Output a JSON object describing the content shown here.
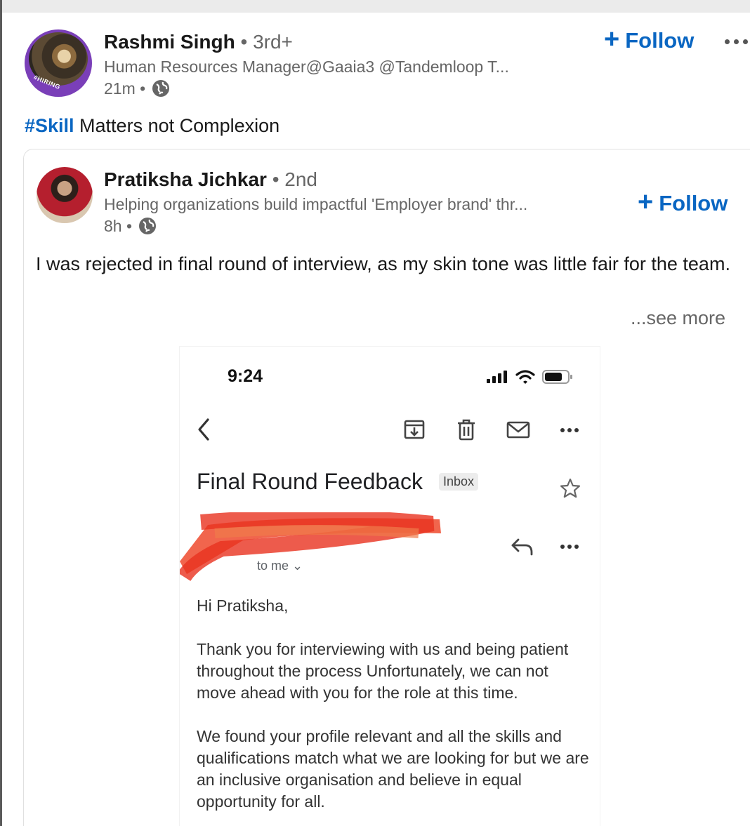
{
  "outer_post": {
    "author_name": "Rashmi Singh",
    "connection_degree": "• 3rd+",
    "headline": "Human Resources Manager@Gaaia3 @Tandemloop T...",
    "time_ago": "21m •",
    "avatar_badge": "#HIRING",
    "follow_label": "Follow",
    "commentary_hashtag": "#Skill",
    "commentary_rest": " Matters not Complexion"
  },
  "shared_post": {
    "author_name": "Pratiksha Jichkar",
    "connection_degree": "• 2nd",
    "headline": "Helping organizations build impactful 'Employer brand' thr...",
    "time_ago": "8h •",
    "follow_label": "Follow",
    "body": "I was rejected in final round of interview, as my skin tone was little fair for the team.",
    "see_more": "...see more"
  },
  "email_screenshot": {
    "status_time": "9:24",
    "subject": "Final Round Feedback",
    "label": "Inbox",
    "recipient": "to me ⌄",
    "greeting": "Hi Pratiksha,",
    "paragraph1": "Thank you for interviewing with us and being patient throughout the process Unfortunately, we can not move ahead with you for the role at this time.",
    "paragraph2": "We found your profile relevant and all the skills and qualifications match what we are looking for but we are an inclusive organisation and believe in equal opportunity for all."
  },
  "colors": {
    "link_blue": "#0a66c2",
    "muted_text": "#666666",
    "badge_purple": "#7a3fb8",
    "redaction_red": "#ef4a2e"
  },
  "icons": [
    "globe-icon",
    "plus-icon",
    "more-icon",
    "back-icon",
    "archive-icon",
    "trash-icon",
    "mail-icon",
    "star-icon",
    "reply-icon",
    "signal-icon",
    "wifi-icon",
    "battery-icon"
  ]
}
